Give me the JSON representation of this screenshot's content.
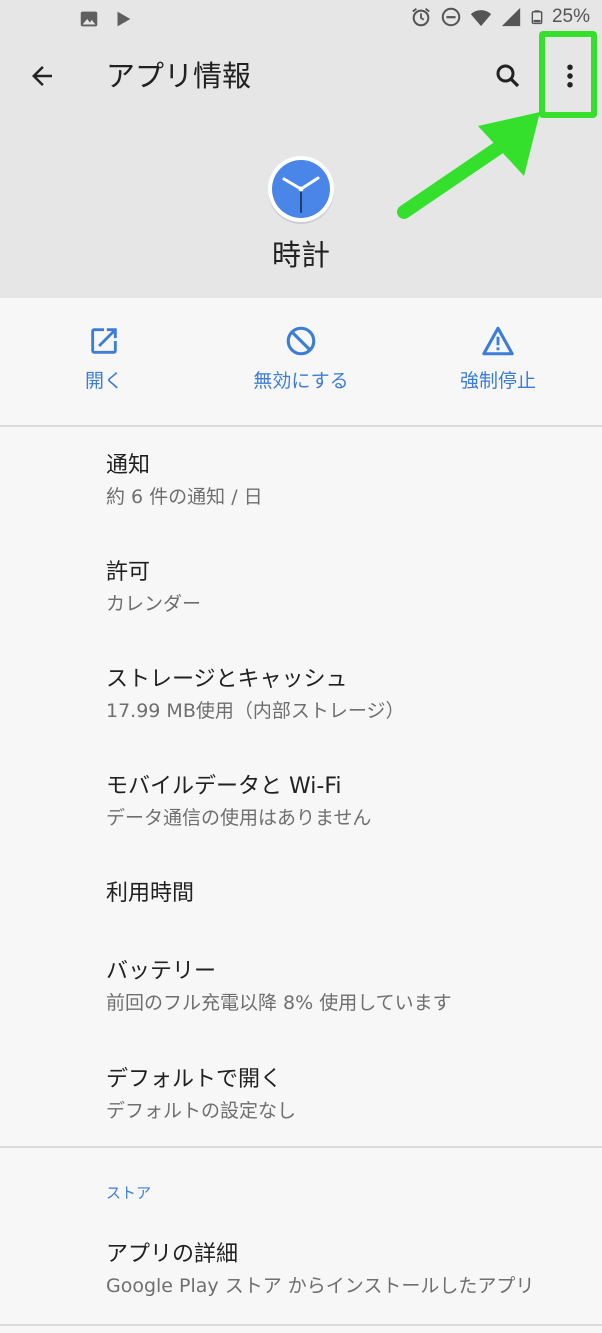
{
  "status_bar": {
    "battery": "25%",
    "left_icons": [
      "image-icon",
      "play-icon"
    ],
    "right_icons": [
      "alarm-icon",
      "do-not-disturb-icon",
      "wifi-icon",
      "signal-icon",
      "battery-icon"
    ]
  },
  "toolbar": {
    "title": "アプリ情報"
  },
  "app": {
    "name": "時計",
    "accent_color": "#4a86e8"
  },
  "actions": [
    {
      "label": "開く",
      "icon": "open-in-new-icon"
    },
    {
      "label": "無効にする",
      "icon": "disable-icon"
    },
    {
      "label": "強制停止",
      "icon": "warning-icon"
    }
  ],
  "settings": [
    {
      "title": "通知",
      "subtitle": "約 6 件の通知 / 日"
    },
    {
      "title": "許可",
      "subtitle": "カレンダー"
    },
    {
      "title": "ストレージとキャッシュ",
      "subtitle": "17.99 MB使用（内部ストレージ）"
    },
    {
      "title": "モバイルデータと Wi-Fi",
      "subtitle": "データ通信の使用はありません"
    },
    {
      "title": "利用時間",
      "subtitle": ""
    },
    {
      "title": "バッテリー",
      "subtitle": "前回のフル充電以降 8% 使用しています"
    },
    {
      "title": "デフォルトで開く",
      "subtitle": "デフォルトの設定なし"
    }
  ],
  "store": {
    "section_label": "ストア",
    "title": "アプリの詳細",
    "subtitle": "Google Play ストア からインストールしたアプリ"
  },
  "colors": {
    "header_bg": "#e6e6e6",
    "page_bg": "#f7f7f7",
    "accent": "#3d7dd8",
    "highlight": "#35e02c"
  }
}
